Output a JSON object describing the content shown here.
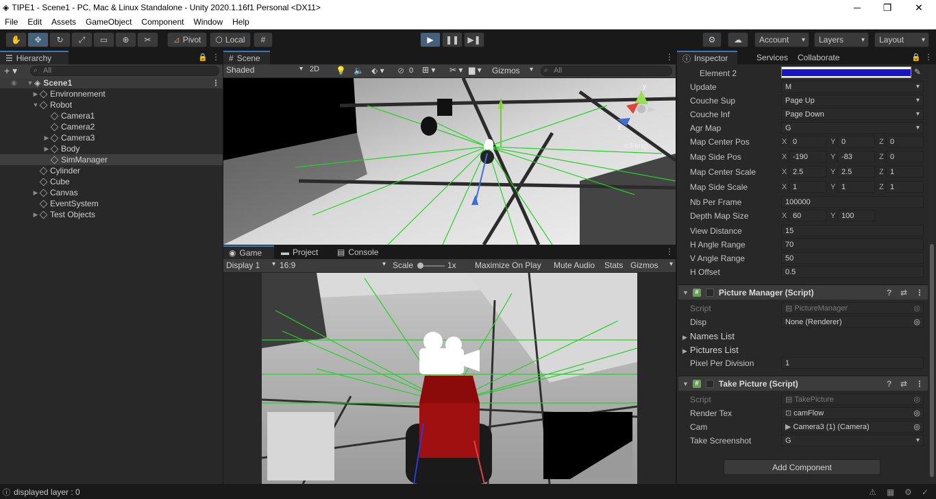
{
  "window": {
    "title": "TIPE1 - Scene1 - PC, Mac & Linux Standalone - Unity 2020.1.16f1 Personal <DX11>"
  },
  "menu": [
    "File",
    "Edit",
    "Assets",
    "GameObject",
    "Component",
    "Window",
    "Help"
  ],
  "toolbar": {
    "pivot": "Pivot",
    "local": "Local",
    "account": "Account",
    "layers": "Layers",
    "layout": "Layout"
  },
  "hierarchy": {
    "tab": "Hierarchy",
    "search_placeholder": "All",
    "scene": "Scene1",
    "items": [
      "Environnement",
      "Robot",
      "Camera1",
      "Camera2",
      "Camera3",
      "Body",
      "SimManager",
      "Cylinder",
      "Cube",
      "Canvas",
      "EventSystem",
      "Test Objects"
    ]
  },
  "scene_view": {
    "tab": "Scene",
    "shading": "Shaded",
    "mode_2d": "2D",
    "hidden_count": "0",
    "gizmos": "Gizmos",
    "search_placeholder": "All",
    "gizmo_label": "< Persp"
  },
  "game_view": {
    "tabs": [
      "Game",
      "Project",
      "Console"
    ],
    "display": "Display 1",
    "aspect": "16:9",
    "scale_label": "Scale",
    "scale_value": "1x",
    "maximize": "Maximize On Play",
    "mute": "Mute Audio",
    "stats": "Stats",
    "gizmos": "Gizmos"
  },
  "inspector": {
    "tabs": [
      "Inspector",
      "Services",
      "Collaborate"
    ],
    "element2_label": "Element 2",
    "element2_color": "#1717c8",
    "props": {
      "update": {
        "label": "Update",
        "value": "M"
      },
      "couche_sup": {
        "label": "Couche Sup",
        "value": "Page Up"
      },
      "couche_inf": {
        "label": "Couche Inf",
        "value": "Page Down"
      },
      "agr_map": {
        "label": "Agr Map",
        "value": "G"
      },
      "map_center_pos": {
        "label": "Map Center Pos",
        "x": "0",
        "y": "0",
        "z": "0"
      },
      "map_side_pos": {
        "label": "Map Side Pos",
        "x": "-190",
        "y": "-83",
        "z": "0"
      },
      "map_center_scale": {
        "label": "Map Center Scale",
        "x": "2.5",
        "y": "2.5",
        "z": "1"
      },
      "map_side_scale": {
        "label": "Map Side Scale",
        "x": "1",
        "y": "1",
        "z": "1"
      },
      "nb_per_frame": {
        "label": "Nb Per Frame",
        "value": "100000"
      },
      "depth_map_size": {
        "label": "Depth Map Size",
        "x": "60",
        "y": "100"
      },
      "view_distance": {
        "label": "View Distance",
        "value": "15"
      },
      "h_angle_range": {
        "label": "H Angle Range",
        "value": "70"
      },
      "v_angle_range": {
        "label": "V Angle Range",
        "value": "50"
      },
      "h_offset": {
        "label": "H Offset",
        "value": "0.5"
      }
    },
    "picture_manager": {
      "title": "Picture Manager (Script)",
      "script_label": "Script",
      "script_value": "PictureManager",
      "disp_label": "Disp",
      "disp_value": "None (Renderer)",
      "names_list": "Names List",
      "pictures_list": "Pictures List",
      "ppd_label": "Pixel Per Division",
      "ppd_value": "1"
    },
    "take_picture": {
      "title": "Take Picture (Script)",
      "script_label": "Script",
      "script_value": "TakePicture",
      "render_tex_label": "Render Tex",
      "render_tex_value": "camFlow",
      "cam_label": "Cam",
      "cam_value": "Camera3 (1) (Camera)",
      "screenshot_label": "Take Screenshot",
      "screenshot_value": "G"
    },
    "add_component": "Add Component",
    "axis": {
      "x": "X",
      "y": "Y",
      "z": "Z"
    }
  },
  "status": {
    "message": "displayed layer : 0"
  },
  "colors": {
    "accent": "#3a79bb",
    "play_active": "#46607c",
    "laser": "#22d322"
  }
}
